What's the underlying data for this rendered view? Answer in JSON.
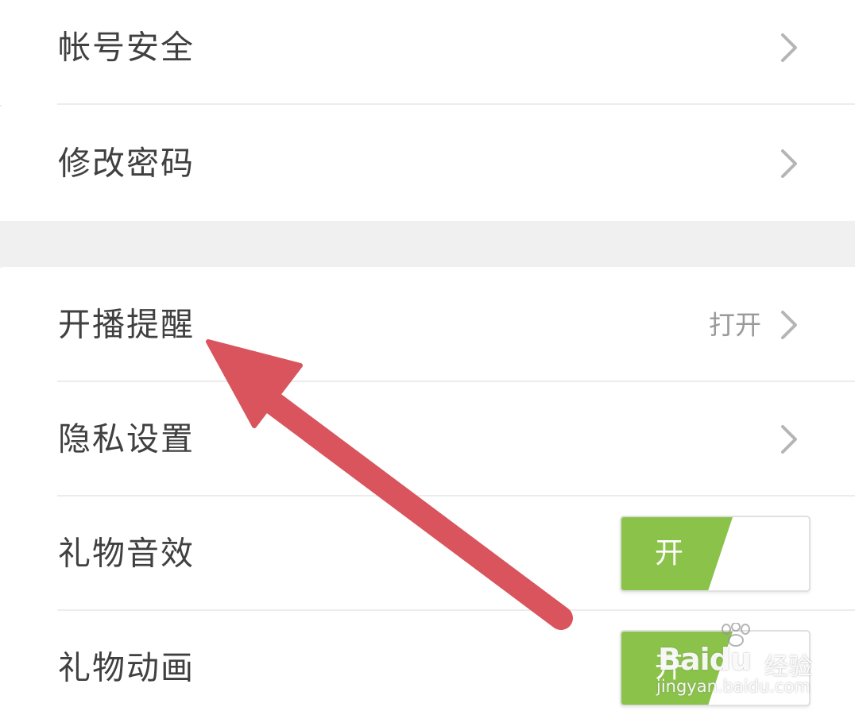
{
  "settings": {
    "items": [
      {
        "label": "帐号安全",
        "control": "chevron"
      },
      {
        "label": "修改密码",
        "control": "chevron"
      },
      {
        "label": "开播提醒",
        "value": "打开",
        "control": "chevron"
      },
      {
        "label": "隐私设置",
        "control": "chevron"
      },
      {
        "label": "礼物音效",
        "control": "toggle",
        "toggle_label": "开",
        "on": true
      },
      {
        "label": "礼物动画",
        "control": "toggle",
        "toggle_label": "开",
        "on": true
      }
    ]
  },
  "annotation": {
    "arrow_color": "#d9545c",
    "points_to": "开播提醒"
  },
  "watermark": {
    "brand": "Baidu",
    "product": "经验",
    "url": "jingyan.baidu.com"
  },
  "colors": {
    "toggle_on": "#8bc34a",
    "label_text": "#404040",
    "value_text": "#9a9a9a",
    "chevron": "#b5b5b5",
    "section_gap": "#f0f0f0"
  },
  "icons": {
    "chevron": "chevron-right-icon",
    "watermark_logo": "paw-icon"
  }
}
